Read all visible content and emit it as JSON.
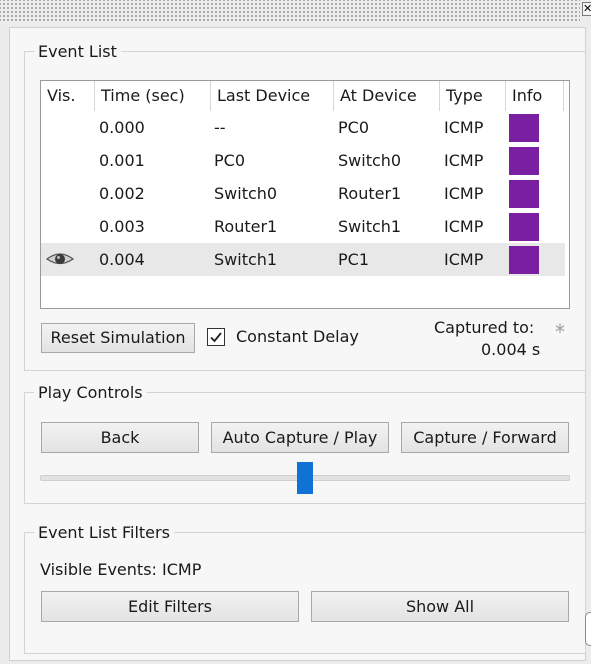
{
  "window": {
    "corner_glyph": "✕"
  },
  "event_list": {
    "title": "Event List",
    "columns": [
      "Vis.",
      "Time (sec)",
      "Last Device",
      "At Device",
      "Type",
      "Info"
    ],
    "rows": [
      {
        "visible_icon": "",
        "time": "0.000",
        "last_device": "--",
        "at_device": "PC0",
        "type": "ICMP",
        "info_color": "#7b1fa2"
      },
      {
        "visible_icon": "",
        "time": "0.001",
        "last_device": "PC0",
        "at_device": "Switch0",
        "type": "ICMP",
        "info_color": "#7b1fa2"
      },
      {
        "visible_icon": "",
        "time": "0.002",
        "last_device": "Switch0",
        "at_device": "Router1",
        "type": "ICMP",
        "info_color": "#7b1fa2"
      },
      {
        "visible_icon": "",
        "time": "0.003",
        "last_device": "Router1",
        "at_device": "Switch1",
        "type": "ICMP",
        "info_color": "#7b1fa2"
      },
      {
        "visible_icon": "eye-icon",
        "time": "0.004",
        "last_device": "Switch1",
        "at_device": "PC1",
        "type": "ICMP",
        "info_color": "#7b1fa2"
      }
    ],
    "reset_label": "Reset Simulation",
    "constant_delay_label": "Constant Delay",
    "constant_delay_checked": true,
    "captured_to_label": "Captured to:",
    "captured_to_value": "0.004 s",
    "asterisk": "*"
  },
  "play_controls": {
    "title": "Play Controls",
    "back_label": "Back",
    "auto_capture_label": "Auto Capture / Play",
    "capture_forward_label": "Capture / Forward",
    "speed_level": 0.5
  },
  "filters": {
    "title": "Event List Filters",
    "visible_events_label": "Visible Events: ICMP",
    "edit_filters_label": "Edit Filters",
    "show_all_label": "Show All"
  },
  "colors": {
    "accent": "#1172d6",
    "info_purple": "#7b1fa2"
  }
}
